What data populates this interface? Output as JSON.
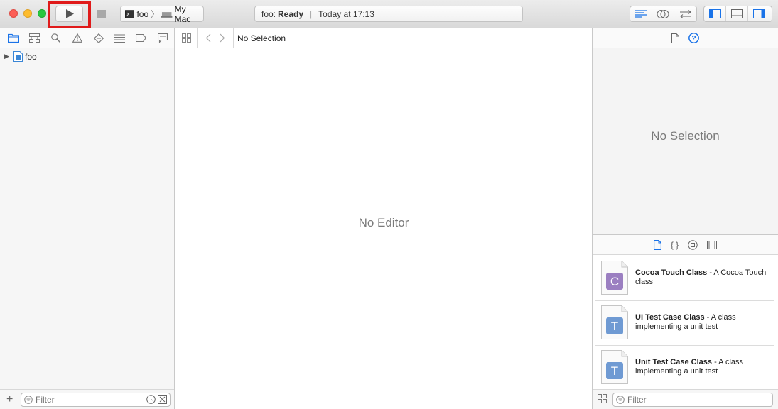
{
  "toolbar": {
    "scheme_target": "foo",
    "scheme_device": "My Mac",
    "status_project": "foo:",
    "status_state": "Ready",
    "status_time": "Today at 17:13"
  },
  "navigator": {
    "tabs": [
      "folder-icon",
      "hierarchy-icon",
      "search-icon",
      "warning-icon",
      "test-diamond-icon",
      "debug-list-icon",
      "breakpoint-icon",
      "report-bubble-icon"
    ],
    "tree": [
      {
        "label": "foo"
      }
    ],
    "filter_placeholder": "Filter"
  },
  "editor": {
    "jumpbar_text": "No Selection",
    "empty_text": "No Editor"
  },
  "inspector": {
    "empty_text": "No Selection",
    "library_items": [
      {
        "icon_letter": "C",
        "icon_color": "#9b7fc1",
        "title": "Cocoa Touch Class",
        "desc": " - A Cocoa Touch class"
      },
      {
        "icon_letter": "T",
        "icon_color": "#6f9ad3",
        "title": "UI Test Case Class",
        "desc": " - A class implementing a unit test"
      },
      {
        "icon_letter": "T",
        "icon_color": "#6f9ad3",
        "title": "Unit Test Case Class",
        "desc": " - A class implementing a unit test"
      }
    ],
    "filter_placeholder": "Filter"
  },
  "colors": {
    "accent": "#1a73e8",
    "highlight": "#e01a1a"
  }
}
